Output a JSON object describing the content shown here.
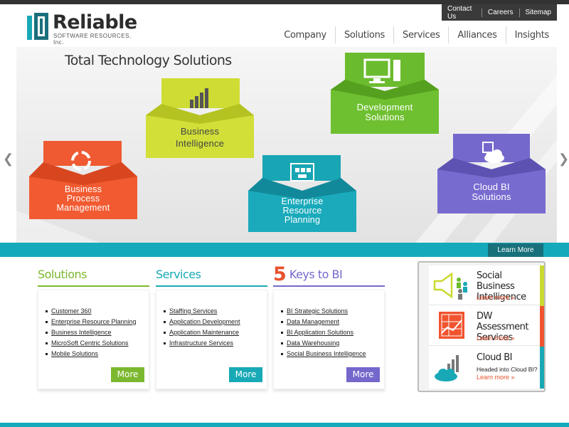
{
  "brand": {
    "name": "Reliable",
    "tagline": "SOFTWARE RESOURCES, Inc."
  },
  "util_nav": [
    "Contact Us",
    "Careers",
    "Sitemap"
  ],
  "main_nav": [
    "Company",
    "Solutions",
    "Services",
    "Alliances",
    "Insights"
  ],
  "hero": {
    "title": "Total Technology Solutions",
    "cards": [
      {
        "id": "bpm",
        "label": [
          "Business",
          "Process",
          "Management"
        ],
        "color": "#f0542f",
        "icon": "cycle-arrows-icon"
      },
      {
        "id": "bi",
        "label": [
          "Business",
          "Intelligence"
        ],
        "color": "#cfdc34",
        "icon": "bar-chart-icon"
      },
      {
        "id": "erp",
        "label": [
          "Enterprise",
          "Resource",
          "Planning"
        ],
        "color": "#19a8b6",
        "icon": "org-chart-icon"
      },
      {
        "id": "dev",
        "label": [
          "Development",
          "Solutions"
        ],
        "color": "#6bbb2e",
        "icon": "computer-icon"
      },
      {
        "id": "cloud",
        "label": [
          "Cloud BI",
          "Solutions"
        ],
        "color": "#7468cc",
        "icon": "cloud-chart-icon"
      }
    ],
    "learn_more": "Learn More"
  },
  "columns": [
    {
      "id": "solutions",
      "title": "Solutions",
      "color": "#7cb82f",
      "items": [
        "Customer 360",
        "Enterprise Resource Planning",
        "Business Intelligence",
        "MicroSoft Centric Solutions",
        "Mobile Solutions"
      ],
      "more": "More"
    },
    {
      "id": "services",
      "title": "Services",
      "color": "#18a9b6",
      "items": [
        "Staffing Services",
        "Application Development",
        "Application Maintenance",
        "Infrastructure Services"
      ],
      "more": "More"
    },
    {
      "id": "keys",
      "title_num": "5",
      "title": "Keys to BI",
      "color": "#7468cc",
      "items": [
        "BI Strategic Solutions",
        "Data Management",
        "BI Application Solutions",
        "Data Warehousing",
        "Social Business Intelligence"
      ],
      "more": "More"
    }
  ],
  "panel": {
    "items": [
      {
        "title": [
          "Social Business",
          "Intelligence"
        ],
        "sub": "",
        "more": "Learn more »",
        "tab_color": "#c9d92f",
        "icon": "megaphone-icon"
      },
      {
        "title": [
          "DW Assessment",
          "Services"
        ],
        "sub": "",
        "more": "Learn more »",
        "tab_color": "#f0542f",
        "icon": "chart-board-icon"
      },
      {
        "title": [
          "Cloud BI"
        ],
        "sub": "Headed into Cloud BI?",
        "more": "Learn more »",
        "tab_color": "#19a8b6",
        "icon": "cloud-bars-icon"
      }
    ]
  }
}
